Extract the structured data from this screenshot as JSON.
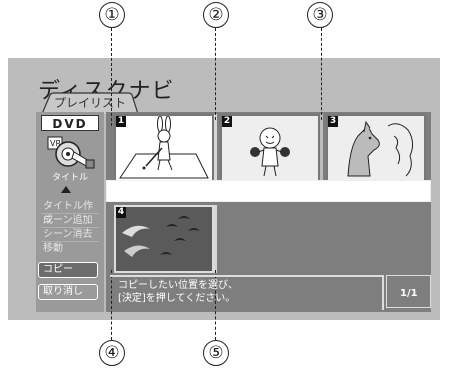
{
  "callouts": [
    "①",
    "②",
    "③",
    "④",
    "⑤"
  ],
  "header": {
    "title": "ディスクナビ",
    "tab": "プレイリスト"
  },
  "sidebar": {
    "dvd_badge": "DVD",
    "disc_label": "タイトル",
    "menu": [
      "タイトル作成",
      "シーン追加",
      "シーン消去",
      "移動"
    ],
    "buttons": [
      "コピー",
      "取り消し"
    ]
  },
  "thumbnails": [
    {
      "number": "1",
      "scene": "rabbit-golf"
    },
    {
      "number": "2",
      "scene": "boxer-character"
    },
    {
      "number": "3",
      "scene": "horse-drawing"
    },
    {
      "number": "4",
      "scene": "birds-flying"
    }
  ],
  "message": {
    "line1": "コピーしたい位置を選び、",
    "line2": "[決定]を押してください。"
  },
  "page_indicator": "1/1"
}
